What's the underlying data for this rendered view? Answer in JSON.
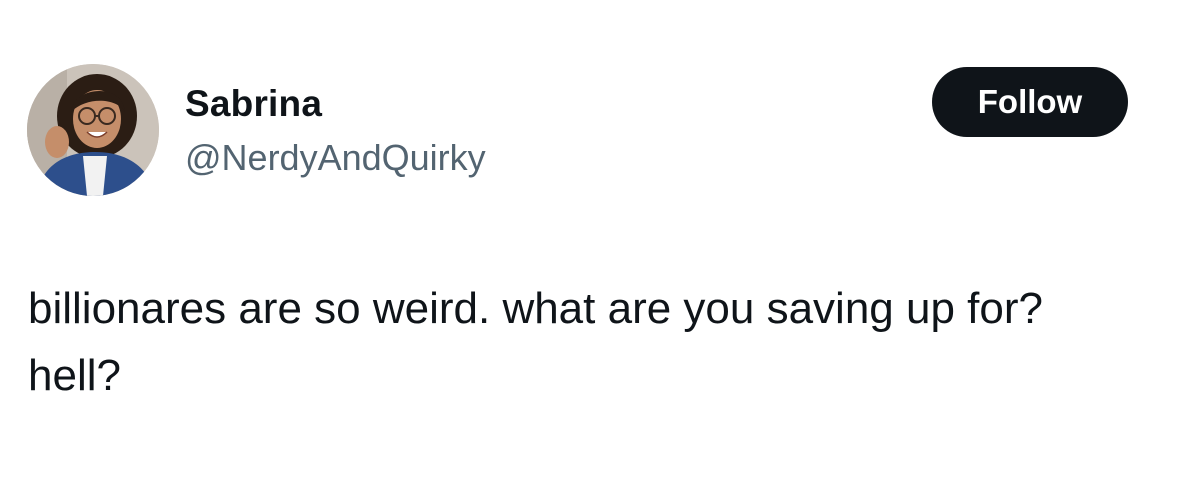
{
  "tweet": {
    "author": {
      "display_name": "Sabrina",
      "handle": "@NerdyAndQuirky",
      "avatar_icon": "profile-photo"
    },
    "follow_button": {
      "label": "Follow"
    },
    "text": "billionares are so weird. what are you saving up for? hell?"
  },
  "colors": {
    "text_primary": "#0f1419",
    "text_secondary": "#536471",
    "button_bg": "#0f1419",
    "button_text": "#ffffff",
    "background": "#ffffff"
  }
}
